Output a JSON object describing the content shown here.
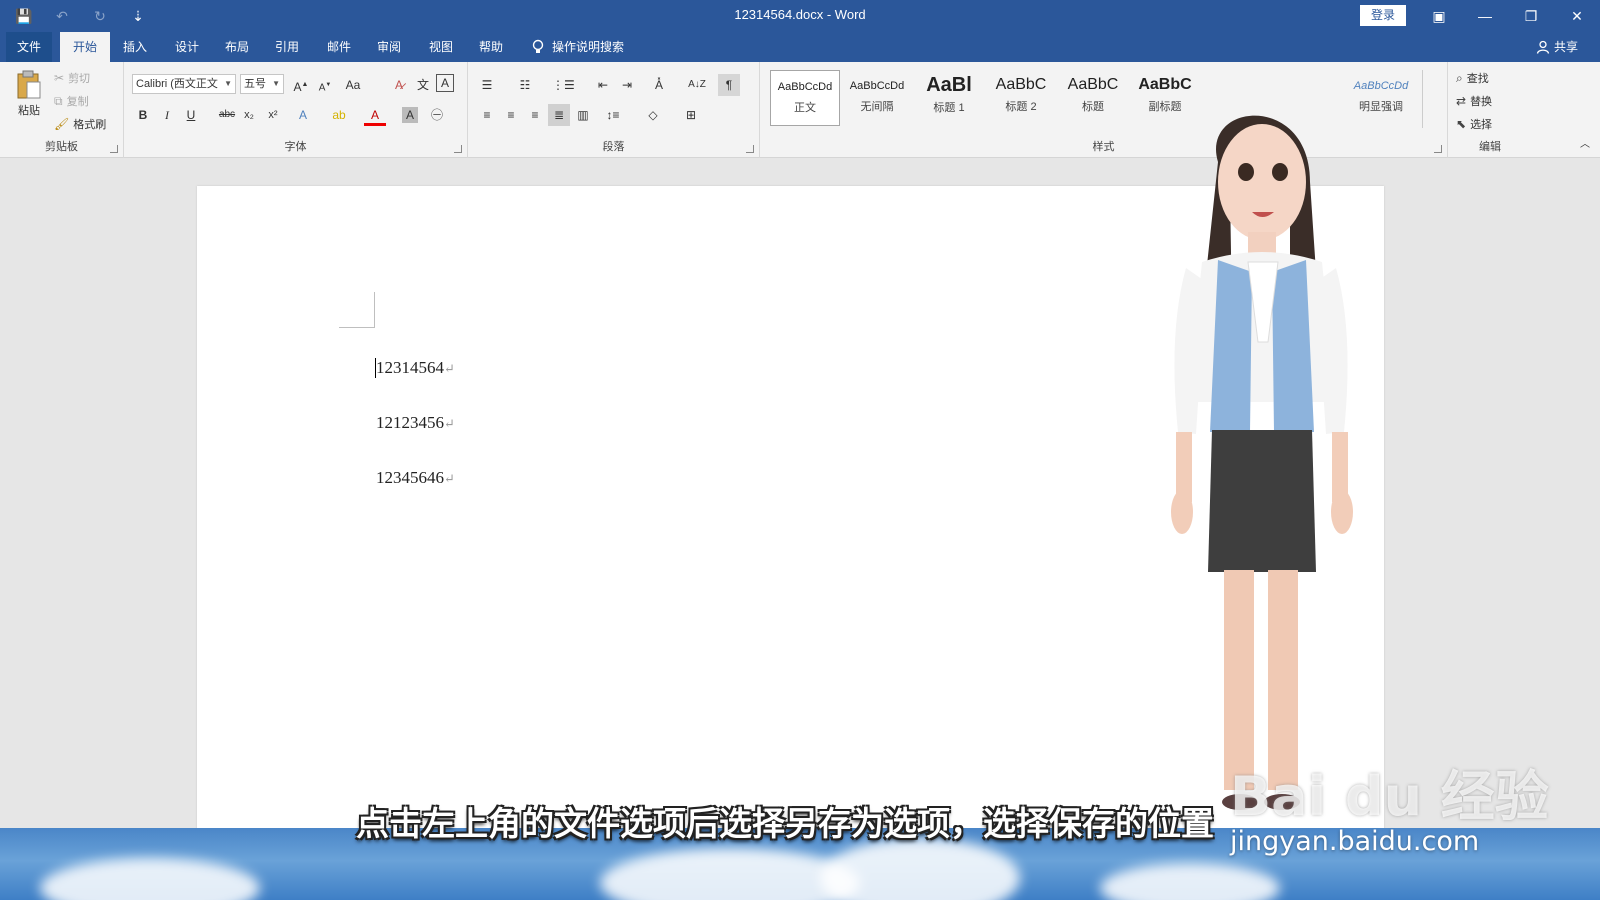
{
  "window": {
    "title": "12314564.docx  -  Word",
    "login": "登录",
    "qat": {
      "save": "💾",
      "undo": "↶",
      "redo": "↻",
      "customize": "⇣"
    },
    "controls": {
      "ribbon_options": "▣",
      "minimize": "—",
      "restore": "❐",
      "close": "✕"
    }
  },
  "tabs": [
    {
      "label": "文件"
    },
    {
      "label": "开始"
    },
    {
      "label": "插入"
    },
    {
      "label": "设计"
    },
    {
      "label": "布局"
    },
    {
      "label": "引用"
    },
    {
      "label": "邮件"
    },
    {
      "label": "审阅"
    },
    {
      "label": "视图"
    },
    {
      "label": "帮助"
    }
  ],
  "tell_me": "操作说明搜索",
  "share": "共享",
  "ribbon": {
    "clipboard": {
      "label": "剪贴板",
      "paste": "粘贴",
      "cut": "剪切",
      "copy": "复制",
      "format_painter": "格式刷"
    },
    "font": {
      "label": "字体",
      "font_name": "Calibri (西文正文",
      "font_size": "五号"
    },
    "paragraph": {
      "label": "段落"
    },
    "styles": {
      "label": "样式",
      "items": [
        {
          "sample": "AaBbCcDd",
          "name": "正文"
        },
        {
          "sample": "AaBbCcDd",
          "name": "无间隔"
        },
        {
          "sample": "AaBl",
          "name": "标题 1"
        },
        {
          "sample": "AaBbC",
          "name": "标题 2"
        },
        {
          "sample": "AaBbC",
          "name": "标题"
        },
        {
          "sample": "AaBbC",
          "name": "副标题"
        },
        {
          "sample": "AaBbCcDd",
          "name": "明显强调"
        }
      ]
    },
    "editing": {
      "label": "编辑",
      "find": "查找",
      "replace": "替换",
      "select": "选择"
    }
  },
  "document": {
    "lines": [
      "12314564",
      "12123456",
      "12345646"
    ],
    "para_mark": "↵"
  },
  "subtitle": "点击左上角的文件选项后选择另存为选项，选择保存的位置",
  "watermark": {
    "brand": "Bai du 经验",
    "url": "jingyan.baidu.com"
  }
}
